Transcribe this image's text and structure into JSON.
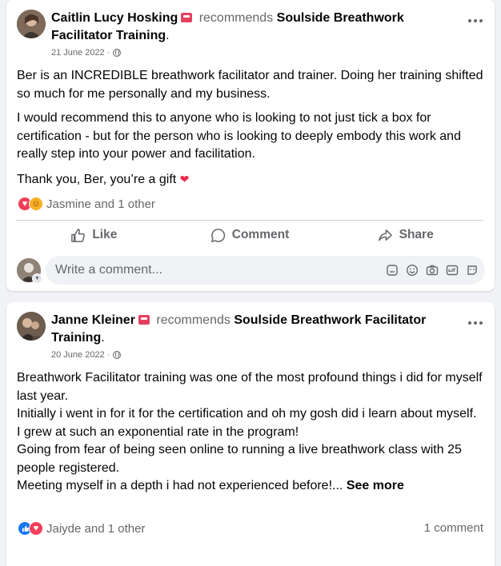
{
  "posts": [
    {
      "author": "Caitlin Lucy Hosking",
      "recommends_word": "recommends",
      "page": "Soulside Breathwork Facilitator Training",
      "date": "21 June 2022 ·",
      "paragraphs": [
        "Ber is an INCREDIBLE breathwork facilitator and trainer. Doing her training shifted so much for me personally and my business.",
        "I would recommend this to anyone who is looking to not just tick a box for certification - but for the person who is looking to deeply embody this work and really step into your power and facilitation.",
        "Thank you, Ber, you’re a gift"
      ],
      "reactions_label": "Jasmine and 1 other",
      "actions": {
        "like": "Like",
        "comment": "Comment",
        "share": "Share"
      },
      "comment_placeholder": "Write a comment..."
    },
    {
      "author": "Janne Kleiner",
      "recommends_word": "recommends",
      "page": "Soulside Breathwork Facilitator Training",
      "date": "20 June 2022 ·",
      "lines": [
        "Breathwork Facilitator training was one of the most profound things i did for myself last year.",
        "Initially i went in for it for the certification and oh my gosh did i learn about myself.",
        "I grew at such an exponential rate in the program!",
        "Going from fear of being seen online to running a live breathwork class with 25 people registered.",
        "Meeting myself in a depth i had not experienced before!..."
      ],
      "see_more": "See more",
      "reactions_label": "Jaiyde and 1 other",
      "comment_count": "1 comment"
    }
  ],
  "icons": {
    "more": "more-options-icon",
    "globe": "globe-icon",
    "recommend": "recommend-badge-icon",
    "like": "thumbs-up-icon",
    "comment": "speech-bubble-icon",
    "share": "share-arrow-icon",
    "sticker": "sticker-icon",
    "emoji": "emoji-icon",
    "camera": "camera-icon",
    "gif": "gif-icon",
    "avatar_sticker": "avatar-sticker-icon"
  },
  "colors": {
    "like_blue": "#1877f2",
    "love_red": "#f33e58",
    "haha_yellow": "#f7b125",
    "secondary_text": "#65676b",
    "badge_pink": "#e4405f"
  }
}
